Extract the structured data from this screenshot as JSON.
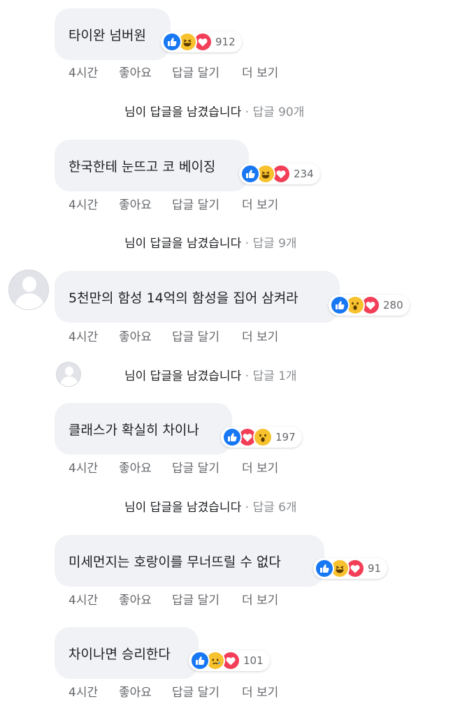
{
  "actions": {
    "time": "4시간",
    "like": "좋아요",
    "reply": "답글 달기",
    "more": "더 보기"
  },
  "reply_summary": {
    "text": "님이 답글을 남겼습니다",
    "separator": "·"
  },
  "comments": [
    {
      "text": "타이완 넘버원",
      "reactions": [
        "like",
        "haha",
        "love"
      ],
      "count": "912",
      "replies": "답글 90개"
    },
    {
      "text": "한국한테 눈뜨고 코 베이징",
      "reactions": [
        "like",
        "haha",
        "love"
      ],
      "count": "234",
      "replies": "답글 9개"
    },
    {
      "text": "5천만의 함성 14억의 함성을 집어 삼켜라",
      "reactions": [
        "like",
        "wow",
        "love"
      ],
      "count": "280",
      "replies": "답글 1개"
    },
    {
      "text": "클래스가 확실히 차이나",
      "reactions": [
        "like",
        "love",
        "wow"
      ],
      "count": "197",
      "replies": "답글 6개"
    },
    {
      "text": "미세먼지는 호랑이를 무너뜨릴 수 없다",
      "reactions": [
        "like",
        "haha",
        "love"
      ],
      "count": "91"
    },
    {
      "text": "차이나면 승리한다",
      "reactions": [
        "like",
        "sad",
        "love"
      ],
      "count": "101"
    }
  ]
}
